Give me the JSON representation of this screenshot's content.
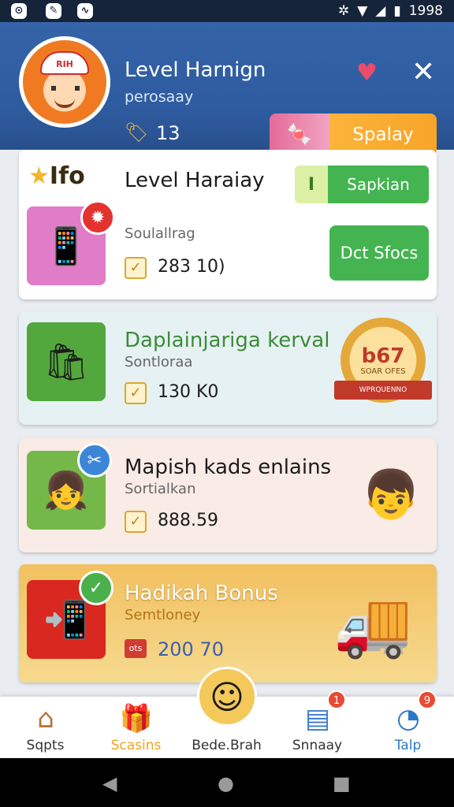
{
  "status_bar": {
    "left_icons": [
      "notification-icon",
      "edit-icon",
      "gallery-icon"
    ],
    "right_icons": [
      "settings-icon",
      "wifi-icon",
      "signal-icon",
      "battery-icon"
    ],
    "time": "1998"
  },
  "header": {
    "title": "Level Harnign",
    "subtitle": "perosaay",
    "coin_count": "13",
    "avatar_cap_text": "RIH",
    "action_button_label": "Spalay"
  },
  "cards": [
    {
      "tag_label": "Ifo",
      "title": "Level Haraiay",
      "subtitle": "Soulallrag",
      "value": "283 10)",
      "pill_prefix": "I",
      "pill_label": "Sapkian",
      "button_label": "Dct Sfocs"
    },
    {
      "title": "Daplainjariga kerval",
      "subtitle": "Sontloraa",
      "value": "130 K0",
      "seal_number": "b67",
      "seal_text": "SOAR OFES",
      "ribbon_text": "WPRQUENNO"
    },
    {
      "title": "Mapish kads enlains",
      "subtitle": "Sortialkan",
      "value": "888.59"
    },
    {
      "title": "Hadikah Bonus",
      "subtitle": "Semtloney",
      "badge_text": "ots",
      "value": "200 70"
    }
  ],
  "bottom_nav": [
    {
      "label": "Sqpts",
      "icon": "home-icon"
    },
    {
      "label": "Scasins",
      "icon": "gift-icon"
    },
    {
      "label": "Bede.Brah",
      "icon": "profile-icon"
    },
    {
      "label": "Snnaay",
      "icon": "notes-icon",
      "count": "1"
    },
    {
      "label": "Talp",
      "icon": "help-icon",
      "count": "9"
    }
  ],
  "colors": {
    "header_blue": "#2e5b9f",
    "accent_orange": "#f7a529",
    "accent_green": "#44b450",
    "card2_title_green": "#3c8c38",
    "nav_active": "#f2a31b",
    "nav_help": "#2a78c9"
  }
}
